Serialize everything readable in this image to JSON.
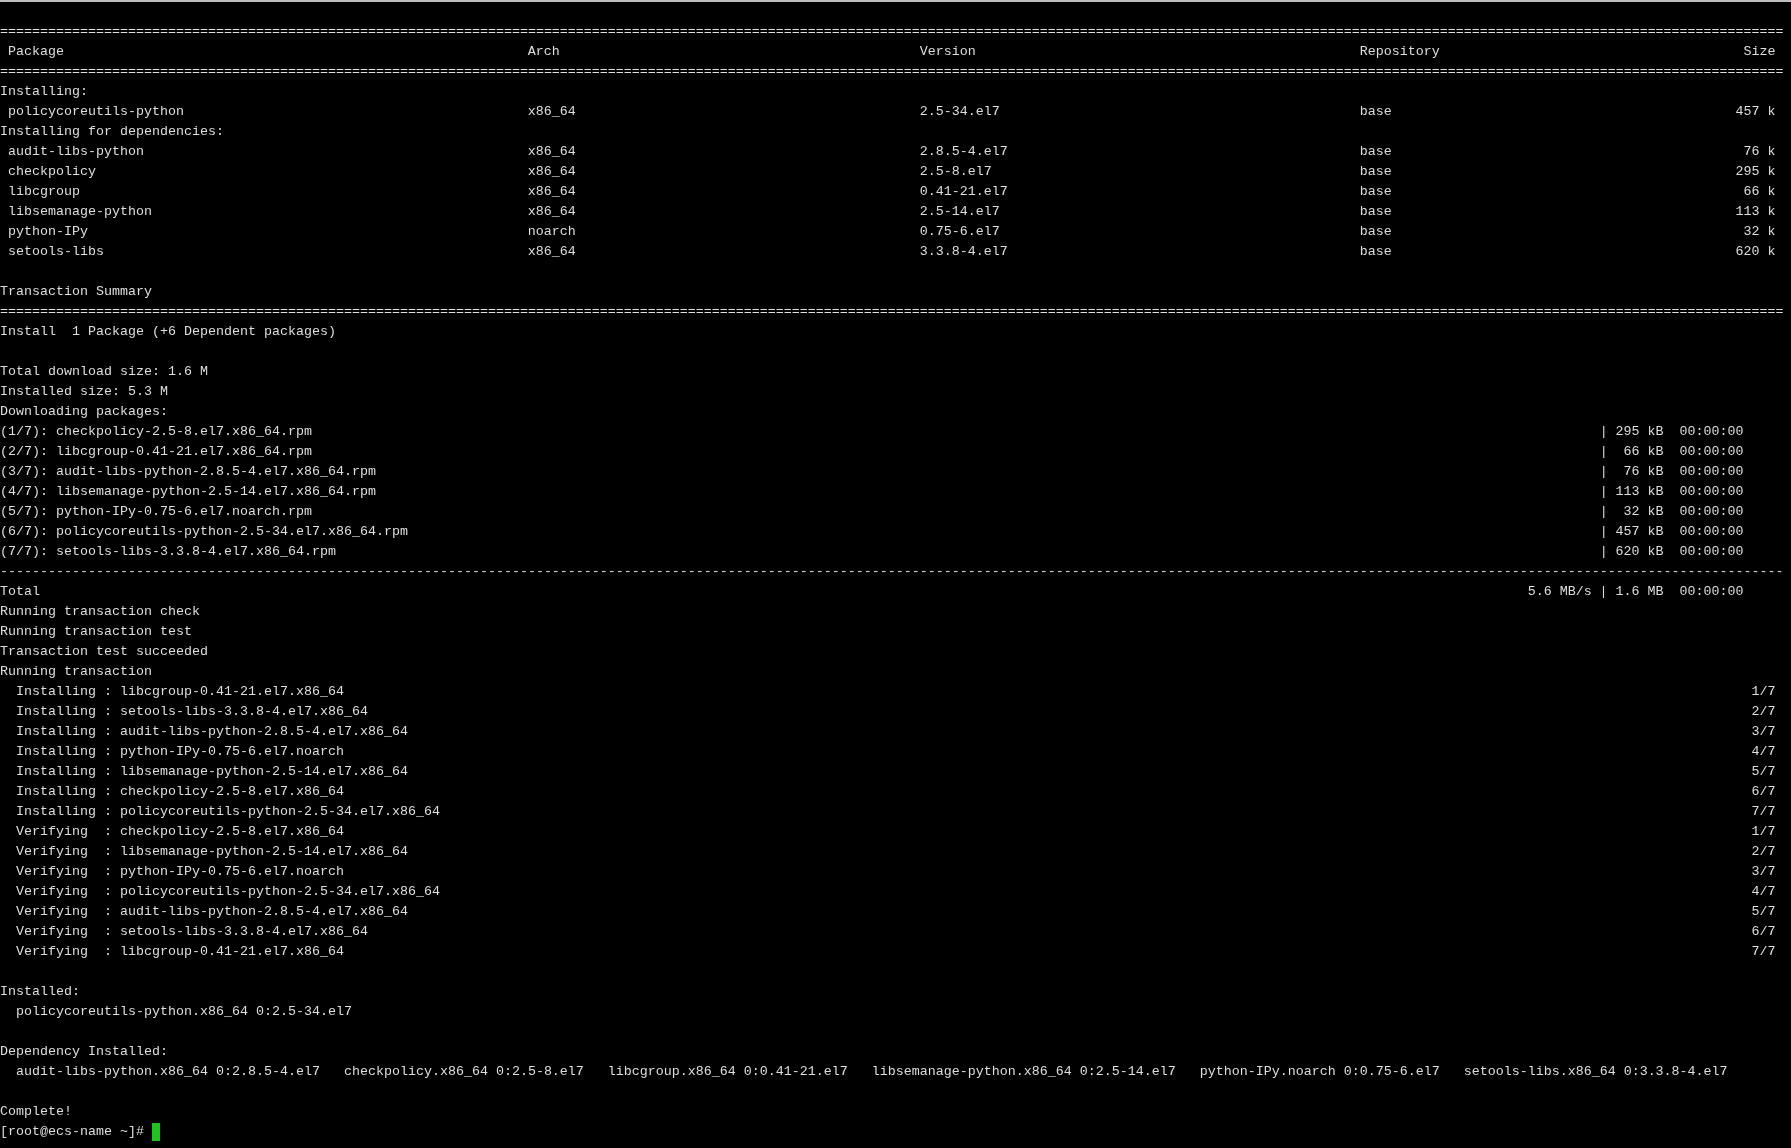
{
  "lines": [
    {
      "kind": "sep",
      "text": "==============================================================================================================================================================================================================================="
    },
    {
      "kind": "header",
      "cells": [
        "Package",
        "Arch",
        "Version",
        "Repository",
        "Size"
      ]
    },
    {
      "kind": "sep",
      "text": "==============================================================================================================================================================================================================================="
    },
    {
      "kind": "text",
      "text": "Installing:"
    },
    {
      "kind": "pkg",
      "cells": [
        "policycoreutils-python",
        "x86_64",
        "2.5-34.el7",
        "base",
        "457 k"
      ]
    },
    {
      "kind": "text",
      "text": "Installing for dependencies:"
    },
    {
      "kind": "pkg",
      "cells": [
        "audit-libs-python",
        "x86_64",
        "2.8.5-4.el7",
        "base",
        "76 k"
      ]
    },
    {
      "kind": "pkg",
      "cells": [
        "checkpolicy",
        "x86_64",
        "2.5-8.el7",
        "base",
        "295 k"
      ]
    },
    {
      "kind": "pkg",
      "cells": [
        "libcgroup",
        "x86_64",
        "0.41-21.el7",
        "base",
        "66 k"
      ]
    },
    {
      "kind": "pkg",
      "cells": [
        "libsemanage-python",
        "x86_64",
        "2.5-14.el7",
        "base",
        "113 k"
      ]
    },
    {
      "kind": "pkg",
      "cells": [
        "python-IPy",
        "noarch",
        "0.75-6.el7",
        "base",
        "32 k"
      ]
    },
    {
      "kind": "pkg",
      "cells": [
        "setools-libs",
        "x86_64",
        "3.3.8-4.el7",
        "base",
        "620 k"
      ]
    },
    {
      "kind": "blank"
    },
    {
      "kind": "text",
      "text": "Transaction Summary"
    },
    {
      "kind": "sep",
      "text": "==============================================================================================================================================================================================================================="
    },
    {
      "kind": "text",
      "text": "Install  1 Package (+6 Dependent packages)"
    },
    {
      "kind": "blank"
    },
    {
      "kind": "text",
      "text": "Total download size: 1.6 M"
    },
    {
      "kind": "text",
      "text": "Installed size: 5.3 M"
    },
    {
      "kind": "text",
      "text": "Downloading packages:"
    },
    {
      "kind": "download",
      "file": "(1/7): checkpolicy-2.5-8.el7.x86_64.rpm",
      "stats": "| 295 kB  00:00:00"
    },
    {
      "kind": "download",
      "file": "(2/7): libcgroup-0.41-21.el7.x86_64.rpm",
      "stats": "|  66 kB  00:00:00"
    },
    {
      "kind": "download",
      "file": "(3/7): audit-libs-python-2.8.5-4.el7.x86_64.rpm",
      "stats": "|  76 kB  00:00:00"
    },
    {
      "kind": "download",
      "file": "(4/7): libsemanage-python-2.5-14.el7.x86_64.rpm",
      "stats": "| 113 kB  00:00:00"
    },
    {
      "kind": "download",
      "file": "(5/7): python-IPy-0.75-6.el7.noarch.rpm",
      "stats": "|  32 kB  00:00:00"
    },
    {
      "kind": "download",
      "file": "(6/7): policycoreutils-python-2.5-34.el7.x86_64.rpm",
      "stats": "| 457 kB  00:00:00"
    },
    {
      "kind": "download",
      "file": "(7/7): setools-libs-3.3.8-4.el7.x86_64.rpm",
      "stats": "| 620 kB  00:00:00"
    },
    {
      "kind": "sep",
      "text": "-------------------------------------------------------------------------------------------------------------------------------------------------------------------------------------------------------------------------------"
    },
    {
      "kind": "download",
      "file": "Total",
      "stats": "5.6 MB/s | 1.6 MB  00:00:00"
    },
    {
      "kind": "text",
      "text": "Running transaction check"
    },
    {
      "kind": "text",
      "text": "Running transaction test"
    },
    {
      "kind": "text",
      "text": "Transaction test succeeded"
    },
    {
      "kind": "text",
      "text": "Running transaction"
    },
    {
      "kind": "step",
      "text": "  Installing : libcgroup-0.41-21.el7.x86_64",
      "count": "1/7"
    },
    {
      "kind": "step",
      "text": "  Installing : setools-libs-3.3.8-4.el7.x86_64",
      "count": "2/7"
    },
    {
      "kind": "step",
      "text": "  Installing : audit-libs-python-2.8.5-4.el7.x86_64",
      "count": "3/7"
    },
    {
      "kind": "step",
      "text": "  Installing : python-IPy-0.75-6.el7.noarch",
      "count": "4/7"
    },
    {
      "kind": "step",
      "text": "  Installing : libsemanage-python-2.5-14.el7.x86_64",
      "count": "5/7"
    },
    {
      "kind": "step",
      "text": "  Installing : checkpolicy-2.5-8.el7.x86_64",
      "count": "6/7"
    },
    {
      "kind": "step",
      "text": "  Installing : policycoreutils-python-2.5-34.el7.x86_64",
      "count": "7/7"
    },
    {
      "kind": "step",
      "text": "  Verifying  : checkpolicy-2.5-8.el7.x86_64",
      "count": "1/7"
    },
    {
      "kind": "step",
      "text": "  Verifying  : libsemanage-python-2.5-14.el7.x86_64",
      "count": "2/7"
    },
    {
      "kind": "step",
      "text": "  Verifying  : python-IPy-0.75-6.el7.noarch",
      "count": "3/7"
    },
    {
      "kind": "step",
      "text": "  Verifying  : policycoreutils-python-2.5-34.el7.x86_64",
      "count": "4/7"
    },
    {
      "kind": "step",
      "text": "  Verifying  : audit-libs-python-2.8.5-4.el7.x86_64",
      "count": "5/7"
    },
    {
      "kind": "step",
      "text": "  Verifying  : setools-libs-3.3.8-4.el7.x86_64",
      "count": "6/7"
    },
    {
      "kind": "step",
      "text": "  Verifying  : libcgroup-0.41-21.el7.x86_64",
      "count": "7/7"
    },
    {
      "kind": "blank"
    },
    {
      "kind": "text",
      "text": "Installed:"
    },
    {
      "kind": "text",
      "text": "  policycoreutils-python.x86_64 0:2.5-34.el7"
    },
    {
      "kind": "blank"
    },
    {
      "kind": "text",
      "text": "Dependency Installed:"
    },
    {
      "kind": "text",
      "text": "  audit-libs-python.x86_64 0:2.8.5-4.el7   checkpolicy.x86_64 0:2.5-8.el7   libcgroup.x86_64 0:0.41-21.el7   libsemanage-python.x86_64 0:2.5-14.el7   python-IPy.noarch 0:0.75-6.el7   setools-libs.x86_64 0:3.3.8-4.el7"
    },
    {
      "kind": "blank"
    },
    {
      "kind": "text",
      "text": "Complete!"
    },
    {
      "kind": "prompt",
      "text": "[root@ecs-name ~]# "
    }
  ]
}
